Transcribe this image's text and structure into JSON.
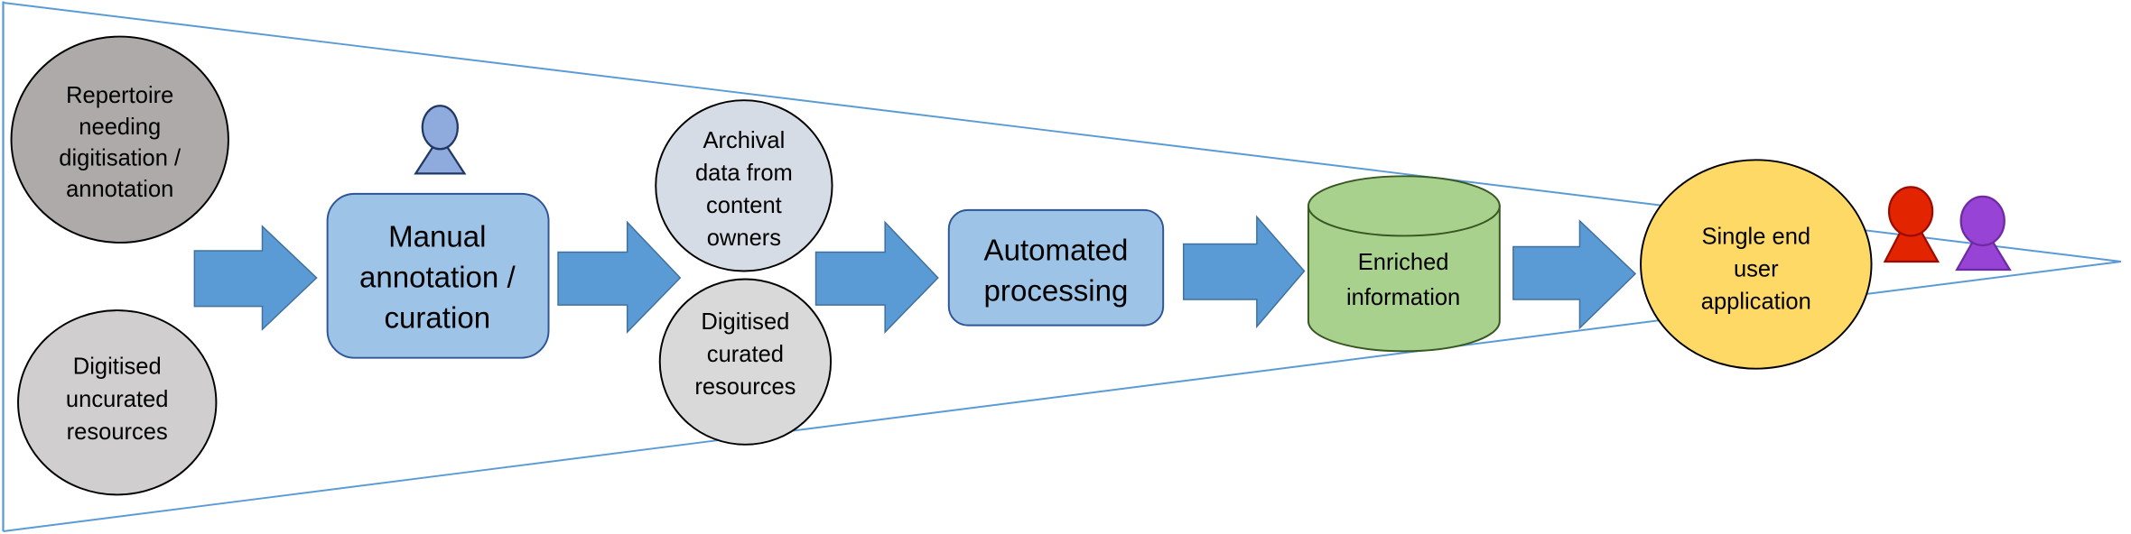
{
  "colors": {
    "funnel": "#5b9bd5",
    "arrow": "#5b9bd5",
    "box": "#9dc3e6",
    "box_stroke": "#2f5597",
    "repertoire": "#aeaaaa",
    "uncurated": "#d0cece",
    "archival": "#d6dce5",
    "curated": "#d9d9d9",
    "database": "#a9d18e",
    "application": "#ffd966",
    "curator_person": "#8faadc",
    "user_person_1": "#e32400",
    "user_person_2": "#9643d6"
  },
  "nodes": {
    "repertoire": [
      "Repertoire",
      "needing",
      "digitisation /",
      "annotation"
    ],
    "uncurated": [
      "Digitised",
      "uncurated",
      "resources"
    ],
    "manual": [
      "Manual",
      "annotation /",
      "curation"
    ],
    "archival": [
      "Archival",
      "data from",
      "content",
      "owners"
    ],
    "curated": [
      "Digitised",
      "curated",
      "resources"
    ],
    "automated": [
      "Automated",
      "processing"
    ],
    "enriched": [
      "Enriched",
      "information"
    ],
    "application": [
      "Single end",
      "user",
      "application"
    ]
  },
  "icons": {
    "curator": "person-icon",
    "users": [
      "person-icon",
      "person-icon"
    ],
    "flow": "arrow-right-icon",
    "database": "cylinder-icon"
  }
}
